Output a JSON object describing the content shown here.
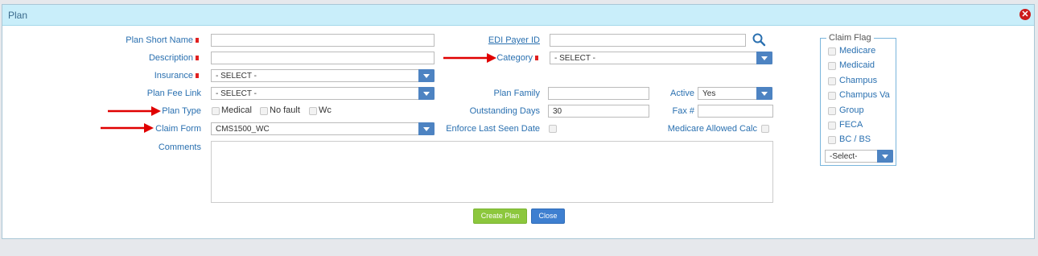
{
  "dialog": {
    "title": "Plan",
    "close_icon": "close-circle-icon"
  },
  "form": {
    "plan_short_name": {
      "label": "Plan Short Name",
      "value": ""
    },
    "description": {
      "label": "Description",
      "value": ""
    },
    "insurance": {
      "label": "Insurance",
      "value": "- SELECT -"
    },
    "plan_fee_link": {
      "label": "Plan Fee Link",
      "value": "- SELECT -"
    },
    "plan_type": {
      "label": "Plan Type",
      "options": [
        "Medical",
        "No fault",
        "Wc"
      ]
    },
    "claim_form": {
      "label": "Claim Form",
      "value": "CMS1500_WC"
    },
    "comments": {
      "label": "Comments",
      "value": ""
    },
    "edi_payer_id": {
      "label": "EDI Payer ID",
      "value": "",
      "search_icon": "search-icon"
    },
    "category": {
      "label": "Category",
      "value": "- SELECT -"
    },
    "plan_family": {
      "label": "Plan Family",
      "value": ""
    },
    "outstanding_days": {
      "label": "Outstanding Days",
      "value": "30"
    },
    "enforce_last_seen_date": {
      "label": "Enforce Last Seen Date"
    },
    "active": {
      "label": "Active",
      "value": "Yes"
    },
    "fax": {
      "label": "Fax #",
      "value": ""
    },
    "medicare_allowed_calc": {
      "label": "Medicare Allowed Calc"
    }
  },
  "claim_flag": {
    "legend": "Claim Flag",
    "items": [
      "Medicare",
      "Medicaid",
      "Champus",
      "Champus Va",
      "Group",
      "FECA",
      "BC / BS"
    ],
    "select_value": "-Select-"
  },
  "buttons": {
    "create": "Create Plan",
    "close": "Close"
  },
  "colors": {
    "title_bar": "#c9eefa",
    "label_blue": "#2a70b0",
    "required_marker": "#e02020",
    "dropdown_button": "#4d83c2",
    "create_button": "#8cc73d",
    "close_button": "#3e7fd0",
    "annotation_arrow": "#e00000"
  }
}
